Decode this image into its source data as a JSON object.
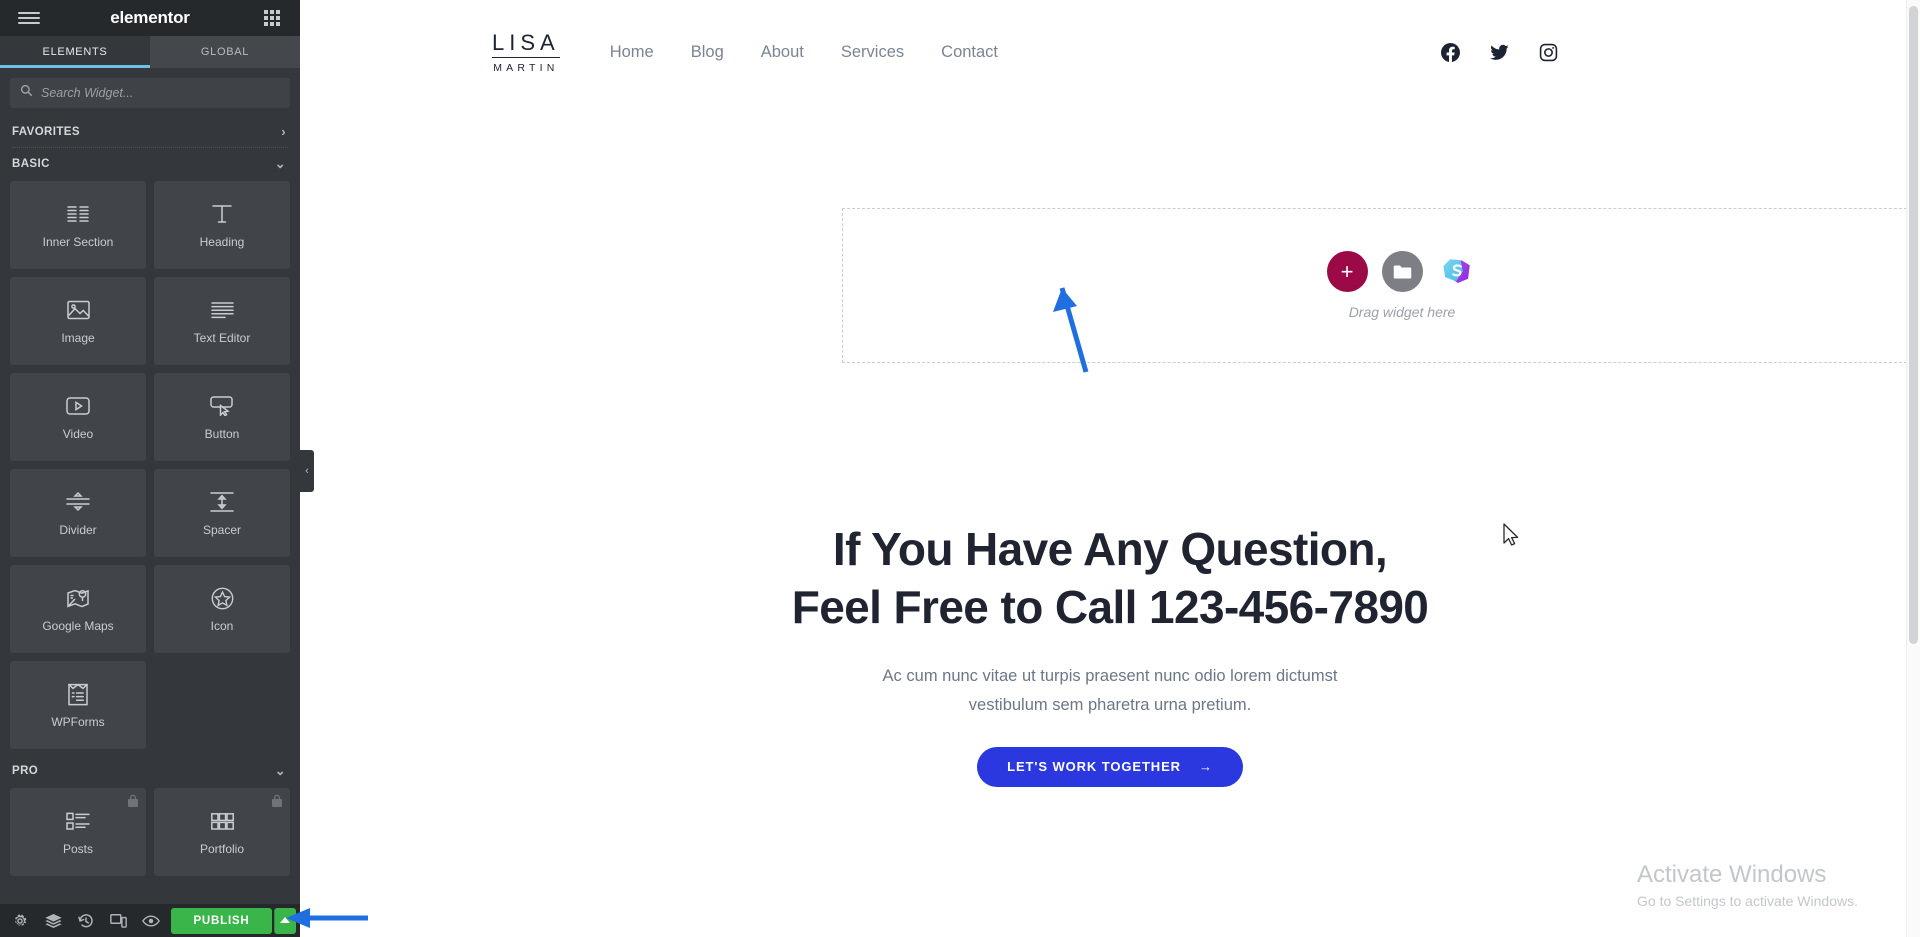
{
  "panel": {
    "brand": "elementor",
    "menu_icon": "hamburger-icon",
    "apps_icon": "grid-icon",
    "tabs": [
      {
        "label": "ELEMENTS",
        "active": true
      },
      {
        "label": "GLOBAL",
        "active": false
      }
    ],
    "search": {
      "placeholder": "Search Widget...",
      "value": "",
      "icon": "search-icon"
    },
    "sections": [
      {
        "title": "FAVORITES",
        "chevron": "›",
        "expanded": false,
        "widgets": []
      },
      {
        "title": "BASIC",
        "chevron": "⌄",
        "expanded": true,
        "widgets": [
          {
            "label": "Inner Section",
            "icon": "inner-section-icon",
            "locked": false
          },
          {
            "label": "Heading",
            "icon": "heading-icon",
            "locked": false
          },
          {
            "label": "Image",
            "icon": "image-icon",
            "locked": false
          },
          {
            "label": "Text Editor",
            "icon": "text-editor-icon",
            "locked": false
          },
          {
            "label": "Video",
            "icon": "video-icon",
            "locked": false
          },
          {
            "label": "Button",
            "icon": "button-icon",
            "locked": false
          },
          {
            "label": "Divider",
            "icon": "divider-icon",
            "locked": false
          },
          {
            "label": "Spacer",
            "icon": "spacer-icon",
            "locked": false
          },
          {
            "label": "Google Maps",
            "icon": "google-maps-icon",
            "locked": false
          },
          {
            "label": "Icon",
            "icon": "star-icon",
            "locked": false
          },
          {
            "label": "WPForms",
            "icon": "wpforms-icon",
            "locked": false
          }
        ]
      },
      {
        "title": "PRO",
        "chevron": "⌄",
        "expanded": true,
        "widgets": [
          {
            "label": "Posts",
            "icon": "posts-icon",
            "locked": true
          },
          {
            "label": "Portfolio",
            "icon": "portfolio-icon",
            "locked": true
          }
        ]
      }
    ],
    "footer": {
      "buttons": [
        {
          "name": "settings-icon",
          "title": "Settings"
        },
        {
          "name": "navigator-icon",
          "title": "Navigator"
        },
        {
          "name": "history-icon",
          "title": "History"
        },
        {
          "name": "responsive-mode-icon",
          "title": "Responsive Mode"
        },
        {
          "name": "preview-icon",
          "title": "Preview Changes"
        }
      ],
      "publish_label": "PUBLISH",
      "publish_caret": "▲",
      "publish_color": "#39b54a"
    },
    "collapse_handle": "‹"
  },
  "site": {
    "logo": {
      "line1": "LISA",
      "line2": "MARTIN"
    },
    "nav": [
      "Home",
      "Blog",
      "About",
      "Services",
      "Contact"
    ],
    "socials": [
      "facebook-icon",
      "twitter-icon",
      "instagram-icon"
    ],
    "dropzone": {
      "label": "Drag widget here",
      "add_button": "+",
      "add_color": "#9b0a46",
      "folder_button": "folder-icon",
      "template_button": "stax-templates-icon"
    },
    "hero": {
      "heading_line1": "If You Have Any Question,",
      "heading_line2": "Feel Free to Call 123-456-7890",
      "paragraph_line1": "Ac cum nunc vitae ut turpis praesent nunc odio lorem dictumst",
      "paragraph_line2": "vestibulum sem pharetra urna pretium.",
      "cta_label": "LET'S WORK TOGETHER",
      "cta_arrow": "→",
      "cta_color": "#2b38e0"
    }
  },
  "watermark": {
    "title": "Activate Windows",
    "subtitle": "Go to Settings to activate Windows."
  }
}
